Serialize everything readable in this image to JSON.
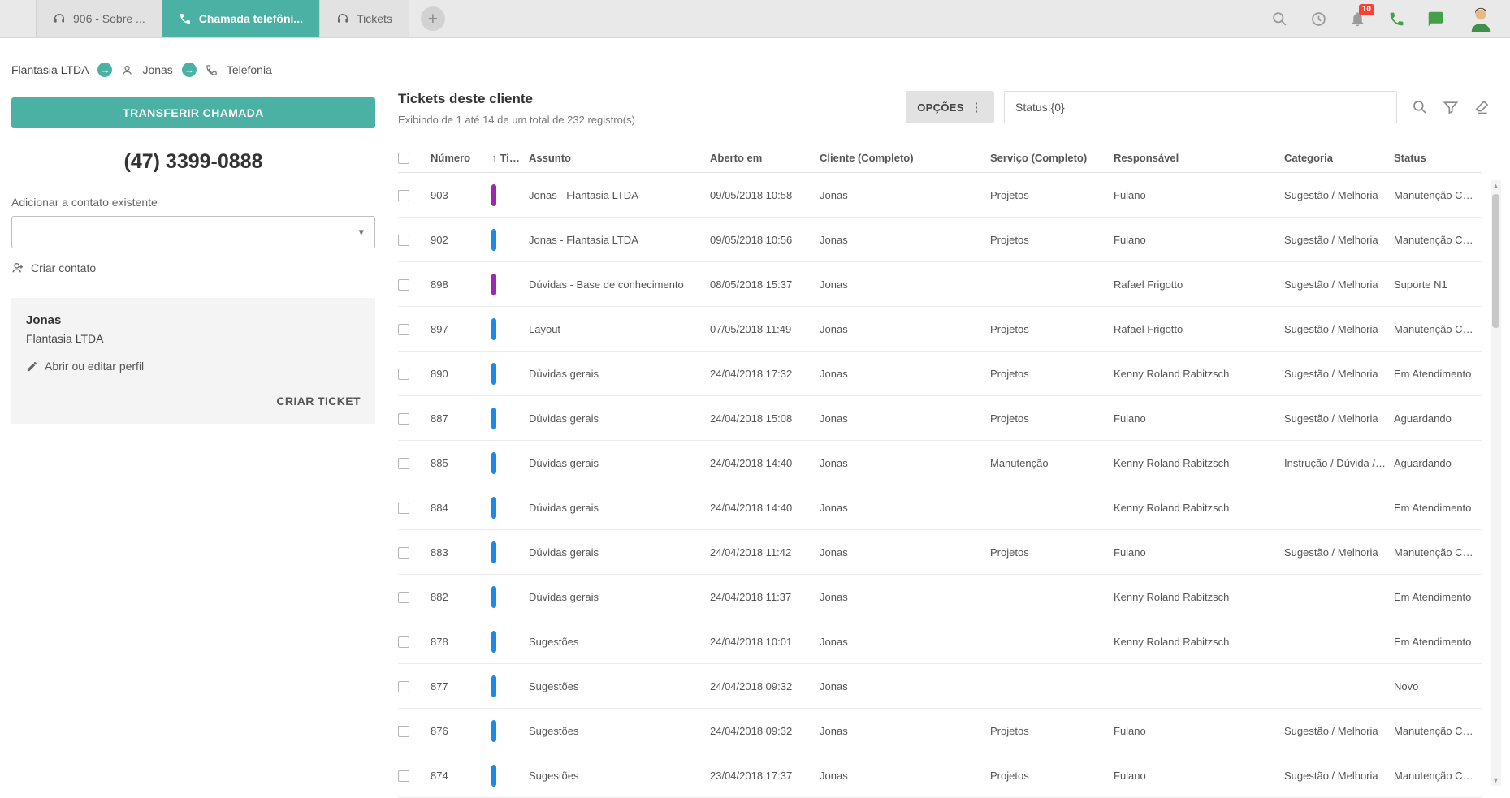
{
  "colors": {
    "accent": "#4ab1a4",
    "badge_red": "#f44336",
    "icon_green": "#43a047",
    "tipo_purple": "#9c27b0",
    "tipo_blue": "#1e88e5"
  },
  "icons": {
    "plus": "+",
    "arrow": "→",
    "caret": "▾",
    "dots": "⋮",
    "sort_arrow": "↑",
    "scroll_up": "▲",
    "scroll_down": "▼"
  },
  "topbar": {
    "tabs": [
      {
        "label": "906 - Sobre ...",
        "icon": "headset",
        "active": false
      },
      {
        "label": "Chamada telefôni...",
        "icon": "phone",
        "active": true
      },
      {
        "label": "Tickets",
        "icon": "headset",
        "active": false
      }
    ],
    "notifications_badge": "10"
  },
  "breadcrumb": {
    "company": "Flantasia LTDA",
    "contact": "Jonas",
    "section": "Telefonia"
  },
  "call_panel": {
    "transfer_button": "TRANSFERIR CHAMADA",
    "phone_number": "(47) 3399-0888",
    "add_contact_label": "Adicionar a contato existente",
    "create_contact": "Criar contato",
    "contact_card": {
      "name": "Jonas",
      "company": "Flantasia LTDA",
      "edit_profile": "Abrir ou editar perfil",
      "create_ticket": "CRIAR TICKET"
    }
  },
  "tickets": {
    "title": "Tickets deste cliente",
    "subtitle": "Exibindo de 1 até 14 de um total de 232 registro(s)",
    "options_button": "OPÇÕES",
    "search_value": "Status:{0}",
    "sort_arrow": "↑",
    "columns": [
      "Número",
      "Tipo",
      "Assunto",
      "Aberto em",
      "Cliente (Completo)",
      "Serviço (Completo)",
      "Responsável",
      "Categoria",
      "Status"
    ],
    "rows": [
      {
        "numero": "903",
        "tipo_color": "#9c27b0",
        "assunto": "Jonas - Flantasia LTDA",
        "aberto_em": "09/05/2018 10:58",
        "cliente": "Jonas",
        "servico": "Projetos",
        "responsavel": "Fulano",
        "categoria": "Sugestão / Melhoria",
        "status": "Manutenção Corretiva"
      },
      {
        "numero": "902",
        "tipo_color": "#1e88e5",
        "assunto": "Jonas - Flantasia LTDA",
        "aberto_em": "09/05/2018 10:56",
        "cliente": "Jonas",
        "servico": "Projetos",
        "responsavel": "Fulano",
        "categoria": "Sugestão / Melhoria",
        "status": "Manutenção Corretiva"
      },
      {
        "numero": "898",
        "tipo_color": "#9c27b0",
        "assunto": "Dúvidas - Base de conhecimento",
        "aberto_em": "08/05/2018 15:37",
        "cliente": "Jonas",
        "servico": "",
        "responsavel": "Rafael Frigotto",
        "categoria": "Sugestão / Melhoria",
        "status": "Suporte N1"
      },
      {
        "numero": "897",
        "tipo_color": "#1e88e5",
        "assunto": "Layout",
        "aberto_em": "07/05/2018 11:49",
        "cliente": "Jonas",
        "servico": "Projetos",
        "responsavel": "Rafael Frigotto",
        "categoria": "Sugestão / Melhoria",
        "status": "Manutenção Corretiva"
      },
      {
        "numero": "890",
        "tipo_color": "#1e88e5",
        "assunto": "Dúvidas gerais",
        "aberto_em": "24/04/2018 17:32",
        "cliente": "Jonas",
        "servico": "Projetos",
        "responsavel": "Kenny Roland Rabitzsch",
        "categoria": "Sugestão / Melhoria",
        "status": "Em Atendimento"
      },
      {
        "numero": "887",
        "tipo_color": "#1e88e5",
        "assunto": "Dúvidas gerais",
        "aberto_em": "24/04/2018 15:08",
        "cliente": "Jonas",
        "servico": "Projetos",
        "responsavel": "Fulano",
        "categoria": "Sugestão / Melhoria",
        "status": "Aguardando"
      },
      {
        "numero": "885",
        "tipo_color": "#1e88e5",
        "assunto": "Dúvidas gerais",
        "aberto_em": "24/04/2018 14:40",
        "cliente": "Jonas",
        "servico": "Manutenção",
        "responsavel": "Kenny Roland Rabitzsch",
        "categoria": "Instrução / Dúvida / C...",
        "status": "Aguardando"
      },
      {
        "numero": "884",
        "tipo_color": "#1e88e5",
        "assunto": "Dúvidas gerais",
        "aberto_em": "24/04/2018 14:40",
        "cliente": "Jonas",
        "servico": "",
        "responsavel": "Kenny Roland Rabitzsch",
        "categoria": "",
        "status": "Em Atendimento"
      },
      {
        "numero": "883",
        "tipo_color": "#1e88e5",
        "assunto": "Dúvidas gerais",
        "aberto_em": "24/04/2018 11:42",
        "cliente": "Jonas",
        "servico": "Projetos",
        "responsavel": "Fulano",
        "categoria": "Sugestão / Melhoria",
        "status": "Manutenção Corretiva"
      },
      {
        "numero": "882",
        "tipo_color": "#1e88e5",
        "assunto": "Dúvidas gerais",
        "aberto_em": "24/04/2018 11:37",
        "cliente": "Jonas",
        "servico": "",
        "responsavel": "Kenny Roland Rabitzsch",
        "categoria": "",
        "status": "Em Atendimento"
      },
      {
        "numero": "878",
        "tipo_color": "#1e88e5",
        "assunto": "Sugestões",
        "aberto_em": "24/04/2018 10:01",
        "cliente": "Jonas",
        "servico": "",
        "responsavel": "Kenny Roland Rabitzsch",
        "categoria": "",
        "status": "Em Atendimento"
      },
      {
        "numero": "877",
        "tipo_color": "#1e88e5",
        "assunto": "Sugestões",
        "aberto_em": "24/04/2018 09:32",
        "cliente": "Jonas",
        "servico": "",
        "responsavel": "",
        "categoria": "",
        "status": "Novo"
      },
      {
        "numero": "876",
        "tipo_color": "#1e88e5",
        "assunto": "Sugestões",
        "aberto_em": "24/04/2018 09:32",
        "cliente": "Jonas",
        "servico": "Projetos",
        "responsavel": "Fulano",
        "categoria": "Sugestão / Melhoria",
        "status": "Manutenção Corretiva"
      },
      {
        "numero": "874",
        "tipo_color": "#1e88e5",
        "assunto": "Sugestões",
        "aberto_em": "23/04/2018 17:37",
        "cliente": "Jonas",
        "servico": "Projetos",
        "responsavel": "Fulano",
        "categoria": "Sugestão / Melhoria",
        "status": "Manutenção Corretiva"
      }
    ]
  }
}
